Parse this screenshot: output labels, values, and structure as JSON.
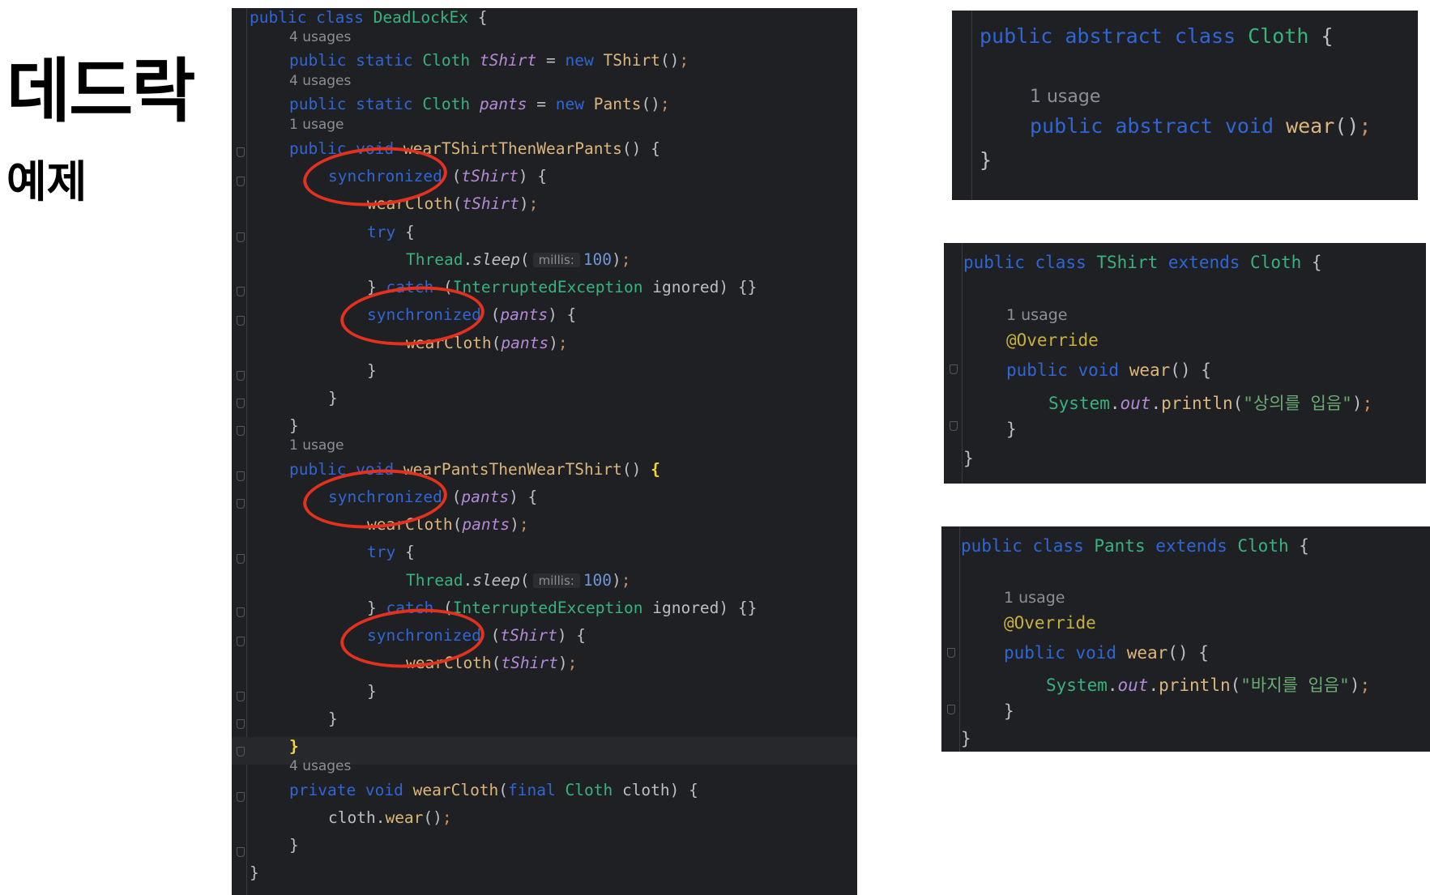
{
  "slide": {
    "title": "데드락",
    "subtitle": "예제"
  },
  "main_code": {
    "lines": [
      [
        [
          "kw",
          "public class "
        ],
        [
          "ty",
          "DeadLockEx"
        ],
        [
          "tx",
          " {"
        ]
      ],
      [
        [
          "kw",
          "public static "
        ],
        [
          "ty",
          "Cloth "
        ],
        [
          "iv",
          "tShirt"
        ],
        [
          "tx",
          " = "
        ],
        [
          "kw",
          "new "
        ],
        [
          "fn",
          "TShirt"
        ],
        [
          "tx",
          "()"
        ],
        [
          "pu",
          ";"
        ]
      ],
      [
        [
          "kw",
          "public static "
        ],
        [
          "ty",
          "Cloth "
        ],
        [
          "iv",
          "pants"
        ],
        [
          "tx",
          " = "
        ],
        [
          "kw",
          "new "
        ],
        [
          "fn",
          "Pants"
        ],
        [
          "tx",
          "()"
        ],
        [
          "pu",
          ";"
        ]
      ],
      [
        [
          "kw",
          "public void "
        ],
        [
          "fn",
          "wearTShirtThenWearPants"
        ],
        [
          "tx",
          "() {"
        ]
      ],
      [
        [
          "kw",
          "synchronized "
        ],
        [
          "tx",
          "("
        ],
        [
          "iv",
          "tShirt"
        ],
        [
          "tx",
          ") {"
        ]
      ],
      [
        [
          "fn",
          "wearCloth"
        ],
        [
          "tx",
          "("
        ],
        [
          "iv",
          "tShirt"
        ],
        [
          "tx",
          ")"
        ],
        [
          "pu",
          ";"
        ]
      ],
      [
        [
          "kw",
          "try "
        ],
        [
          "tx",
          "{"
        ]
      ],
      [
        [
          "ty",
          "Thread"
        ],
        [
          "tx",
          "."
        ],
        [
          "it",
          "sleep"
        ],
        [
          "tx",
          "("
        ],
        [
          "hint",
          "millis:"
        ],
        [
          "nm",
          "100"
        ],
        [
          "tx",
          ")"
        ],
        [
          "pu",
          ";"
        ]
      ],
      [
        [
          "tx",
          "} "
        ],
        [
          "kw",
          "catch "
        ],
        [
          "tx",
          "("
        ],
        [
          "ty",
          "InterruptedException "
        ],
        [
          "tx",
          "ignored) {}"
        ]
      ],
      [
        [
          "kw",
          "synchronized "
        ],
        [
          "tx",
          "("
        ],
        [
          "iv",
          "pants"
        ],
        [
          "tx",
          ") {"
        ]
      ],
      [
        [
          "fn",
          "wearCloth"
        ],
        [
          "tx",
          "("
        ],
        [
          "iv",
          "pants"
        ],
        [
          "tx",
          ")"
        ],
        [
          "pu",
          ";"
        ]
      ],
      [
        [
          "tx",
          "}"
        ]
      ],
      [
        [
          "tx",
          "}"
        ]
      ],
      [
        [
          "tx",
          "}"
        ]
      ],
      [
        [
          "kw",
          "public void "
        ],
        [
          "fn",
          "wearPantsThenWearTShirt"
        ],
        [
          "tx",
          "() "
        ],
        [
          "br",
          "{"
        ]
      ],
      [
        [
          "kw",
          "synchronized "
        ],
        [
          "tx",
          "("
        ],
        [
          "iv",
          "pants"
        ],
        [
          "tx",
          ") {"
        ]
      ],
      [
        [
          "fn",
          "wearCloth"
        ],
        [
          "tx",
          "("
        ],
        [
          "iv",
          "pants"
        ],
        [
          "tx",
          ")"
        ],
        [
          "pu",
          ";"
        ]
      ],
      [
        [
          "kw",
          "try "
        ],
        [
          "tx",
          "{"
        ]
      ],
      [
        [
          "ty",
          "Thread"
        ],
        [
          "tx",
          "."
        ],
        [
          "it",
          "sleep"
        ],
        [
          "tx",
          "("
        ],
        [
          "hint",
          "millis:"
        ],
        [
          "nm",
          "100"
        ],
        [
          "tx",
          ")"
        ],
        [
          "pu",
          ";"
        ]
      ],
      [
        [
          "tx",
          "} "
        ],
        [
          "kw",
          "catch "
        ],
        [
          "tx",
          "("
        ],
        [
          "ty",
          "InterruptedException "
        ],
        [
          "tx",
          "ignored) {}"
        ]
      ],
      [
        [
          "kw",
          "synchronized "
        ],
        [
          "tx",
          "("
        ],
        [
          "iv",
          "tShirt"
        ],
        [
          "tx",
          ") {"
        ]
      ],
      [
        [
          "fn",
          "wearCloth"
        ],
        [
          "tx",
          "("
        ],
        [
          "iv",
          "tShirt"
        ],
        [
          "tx",
          ")"
        ],
        [
          "pu",
          ";"
        ]
      ],
      [
        [
          "tx",
          "}"
        ]
      ],
      [
        [
          "tx",
          "}"
        ]
      ],
      [
        [
          "br",
          "}"
        ]
      ],
      [
        [
          "kw",
          "private void "
        ],
        [
          "fn",
          "wearCloth"
        ],
        [
          "tx",
          "("
        ],
        [
          "kw",
          "final "
        ],
        [
          "ty",
          "Cloth "
        ],
        [
          "tx",
          "cloth) {"
        ]
      ],
      [
        [
          "tx",
          "cloth."
        ],
        [
          "fn",
          "wear"
        ],
        [
          "tx",
          "()"
        ],
        [
          "pu",
          ";"
        ]
      ],
      [
        [
          "tx",
          "}"
        ]
      ],
      [
        [
          "tx",
          "}"
        ]
      ]
    ],
    "usages": [
      "4 usages",
      "4 usages",
      "1 usage",
      "1 usage",
      "4 usages"
    ]
  },
  "cloth_code": {
    "lines": [
      [
        [
          "kw",
          "public abstract class "
        ],
        [
          "ty",
          "Cloth "
        ],
        [
          "tx",
          "{"
        ]
      ],
      [
        [
          "kw",
          "public abstract void "
        ],
        [
          "fn",
          "wear"
        ],
        [
          "tx",
          "()"
        ],
        [
          "pu",
          ";"
        ]
      ],
      [
        [
          "tx",
          "}"
        ]
      ]
    ],
    "usages": [
      "1 usage"
    ]
  },
  "tshirt_code": {
    "lines": [
      [
        [
          "kw",
          "public class "
        ],
        [
          "ty",
          "TShirt "
        ],
        [
          "kw",
          "extends "
        ],
        [
          "ty",
          "Cloth "
        ],
        [
          "tx",
          "{"
        ]
      ],
      [
        [
          "an",
          "@Override"
        ]
      ],
      [
        [
          "kw",
          "public void "
        ],
        [
          "fn",
          "wear"
        ],
        [
          "tx",
          "() {"
        ]
      ],
      [
        [
          "ty",
          "System"
        ],
        [
          "tx",
          "."
        ],
        [
          "iv",
          "out"
        ],
        [
          "tx",
          "."
        ],
        [
          "fn",
          "println"
        ],
        [
          "tx",
          "("
        ],
        [
          "st",
          "\"상의를 입음\""
        ],
        [
          "tx",
          ")"
        ],
        [
          "pu",
          ";"
        ]
      ],
      [
        [
          "tx",
          "}"
        ]
      ],
      [
        [
          "tx",
          "}"
        ]
      ]
    ],
    "usages": [
      "1 usage"
    ]
  },
  "pants_code": {
    "lines": [
      [
        [
          "kw",
          "public class "
        ],
        [
          "ty",
          "Pants "
        ],
        [
          "kw",
          "extends "
        ],
        [
          "ty",
          "Cloth "
        ],
        [
          "tx",
          "{"
        ]
      ],
      [
        [
          "an",
          "@Override"
        ]
      ],
      [
        [
          "kw",
          "public void "
        ],
        [
          "fn",
          "wear"
        ],
        [
          "tx",
          "() {"
        ]
      ],
      [
        [
          "ty",
          "System"
        ],
        [
          "tx",
          "."
        ],
        [
          "iv",
          "out"
        ],
        [
          "tx",
          "."
        ],
        [
          "fn",
          "println"
        ],
        [
          "tx",
          "("
        ],
        [
          "st",
          "\"바지를 입음\""
        ],
        [
          "tx",
          ")"
        ],
        [
          "pu",
          ";"
        ]
      ],
      [
        [
          "tx",
          "}"
        ]
      ],
      [
        [
          "tx",
          "}"
        ]
      ]
    ],
    "usages": [
      "1 usage"
    ]
  }
}
